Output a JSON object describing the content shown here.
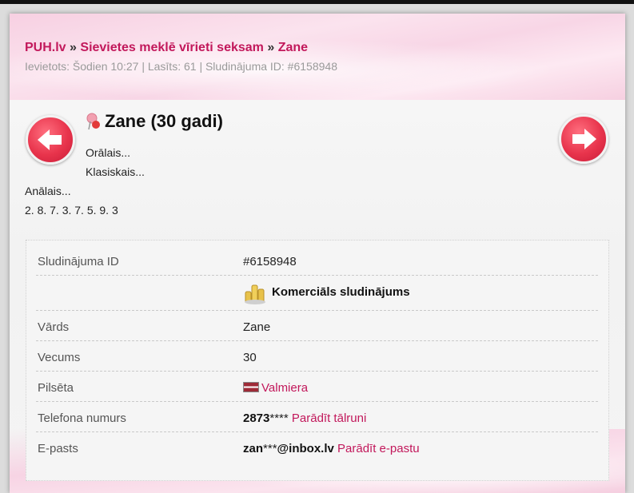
{
  "breadcrumb": {
    "site": "PUH.lv",
    "separator": "»",
    "category": "Sievietes meklē vīrieti seksam",
    "current": "Zane"
  },
  "meta_line": "Ievietots: Šodien 10:27 | Lasīts: 61 | Sludinājuma ID: #6158948",
  "listing": {
    "title": "Zane (30 gadi)",
    "description_lines": [
      "Orālais...",
      "Klasiskais...",
      "Anālais...",
      "2. 8. 7. 3. 7. 5. 9. 3"
    ]
  },
  "details": {
    "id_label": "Sludinājuma ID",
    "id_value": "#6158948",
    "commercial_label": "Komerciāls sludinājums",
    "name_label": "Vārds",
    "name_value": "Zane",
    "age_label": "Vecums",
    "age_value": "30",
    "city_label": "Pilsēta",
    "city_value": "Valmiera",
    "phone_label": "Telefona numurs",
    "phone_bold": "2873",
    "phone_mask": "****",
    "phone_link": "Parādīt tālruni",
    "email_label": "E-pasts",
    "email_bold_1": "zan",
    "email_mask": "***",
    "email_bold_2": "@inbox.lv",
    "email_link": "Parādīt e-pastu"
  },
  "icons": {
    "prev": "left-arrow-icon",
    "next": "right-arrow-icon",
    "pin": "pin-icon",
    "commercial": "coins-icon",
    "flag": "latvia-flag-icon"
  },
  "colors": {
    "accent": "#c2185b",
    "arrow_red": "#e8344c"
  }
}
